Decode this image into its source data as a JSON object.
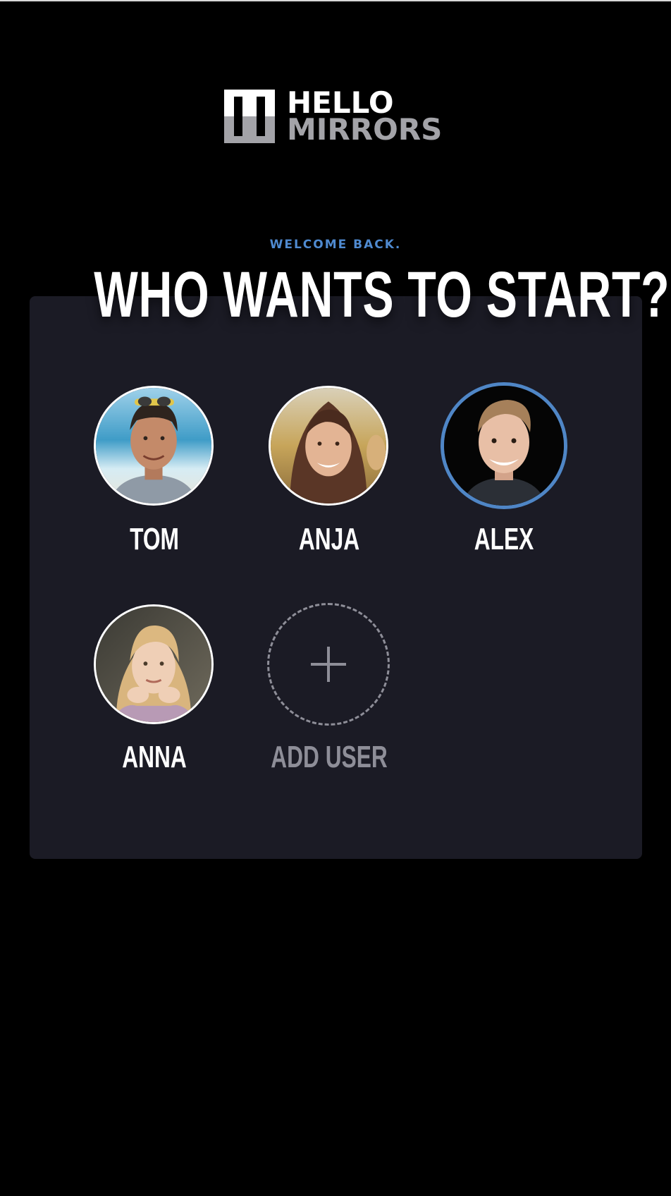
{
  "brand": {
    "name_line1": "HELLO",
    "name_line2": "MIRRORS",
    "logo_icon": "hello-mirrors-logo-icon"
  },
  "colors": {
    "background": "#000000",
    "panel": "#1b1b25",
    "accent": "#4f86c6",
    "muted": "#8e8e98"
  },
  "header": {
    "welcome": "WELCOME BACK.",
    "headline": "WHO WANTS TO START?"
  },
  "profiles": [
    {
      "name": "TOM",
      "selected": false
    },
    {
      "name": "ANJA",
      "selected": false
    },
    {
      "name": "ALEX",
      "selected": true
    },
    {
      "name": "ANNA",
      "selected": false
    }
  ],
  "add_user": {
    "label": "ADD USER",
    "icon": "plus-icon"
  }
}
